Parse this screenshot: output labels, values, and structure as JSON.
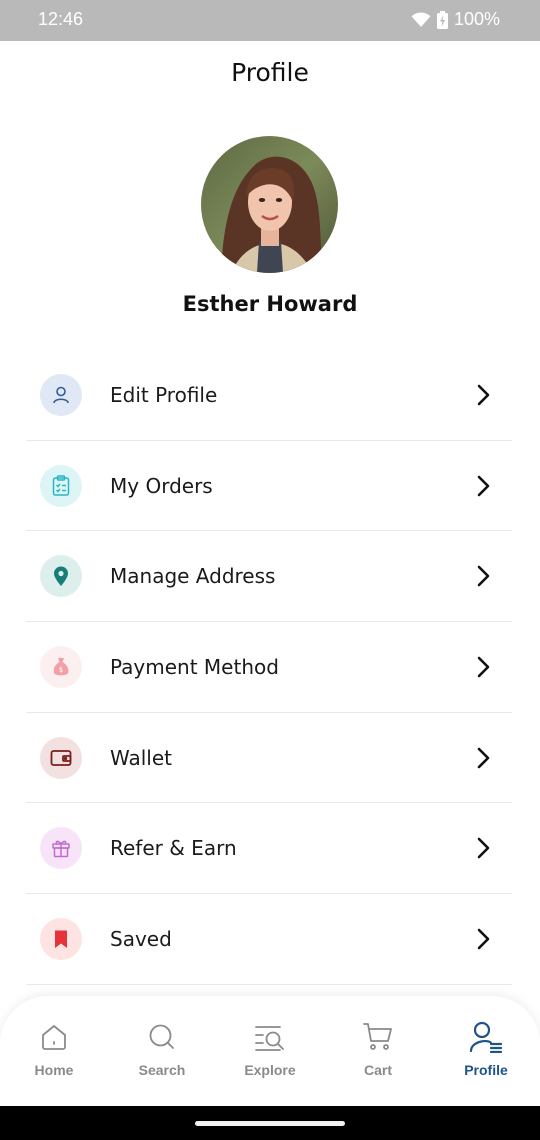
{
  "status_bar": {
    "time": "12:46",
    "battery": "100%"
  },
  "header": {
    "title": "Profile"
  },
  "profile": {
    "name": "Esther Howard"
  },
  "menu": [
    {
      "label": "Edit Profile",
      "icon": "user-icon",
      "bg": "#dfe8f4",
      "fg": "#2f5d9a"
    },
    {
      "label": "My Orders",
      "icon": "clipboard-list-icon",
      "bg": "#def5f7",
      "fg": "#27b6c4"
    },
    {
      "label": "Manage Address",
      "icon": "location-pin-icon",
      "bg": "#dcefec",
      "fg": "#167e76"
    },
    {
      "label": "Payment Method",
      "icon": "money-bag-icon",
      "bg": "#fcefef",
      "fg": "#f2a0a8"
    },
    {
      "label": "Wallet",
      "icon": "wallet-icon",
      "bg": "#f3e1e1",
      "fg": "#7b1e1e"
    },
    {
      "label": "Refer & Earn",
      "icon": "gift-icon",
      "bg": "#f7e4f8",
      "fg": "#c46bd0"
    },
    {
      "label": "Saved",
      "icon": "bookmark-icon",
      "bg": "#fde3e1",
      "fg": "#e6333a"
    }
  ],
  "bottom_nav": [
    {
      "label": "Home",
      "icon": "home-icon"
    },
    {
      "label": "Search",
      "icon": "search-icon"
    },
    {
      "label": "Explore",
      "icon": "explore-icon"
    },
    {
      "label": "Cart",
      "icon": "cart-icon"
    },
    {
      "label": "Profile",
      "icon": "profile-icon",
      "active": true
    }
  ],
  "colors": {
    "accent": "#1f5389",
    "nav_inactive": "#8a8a8a",
    "status_bar": "#b9b9b9"
  }
}
